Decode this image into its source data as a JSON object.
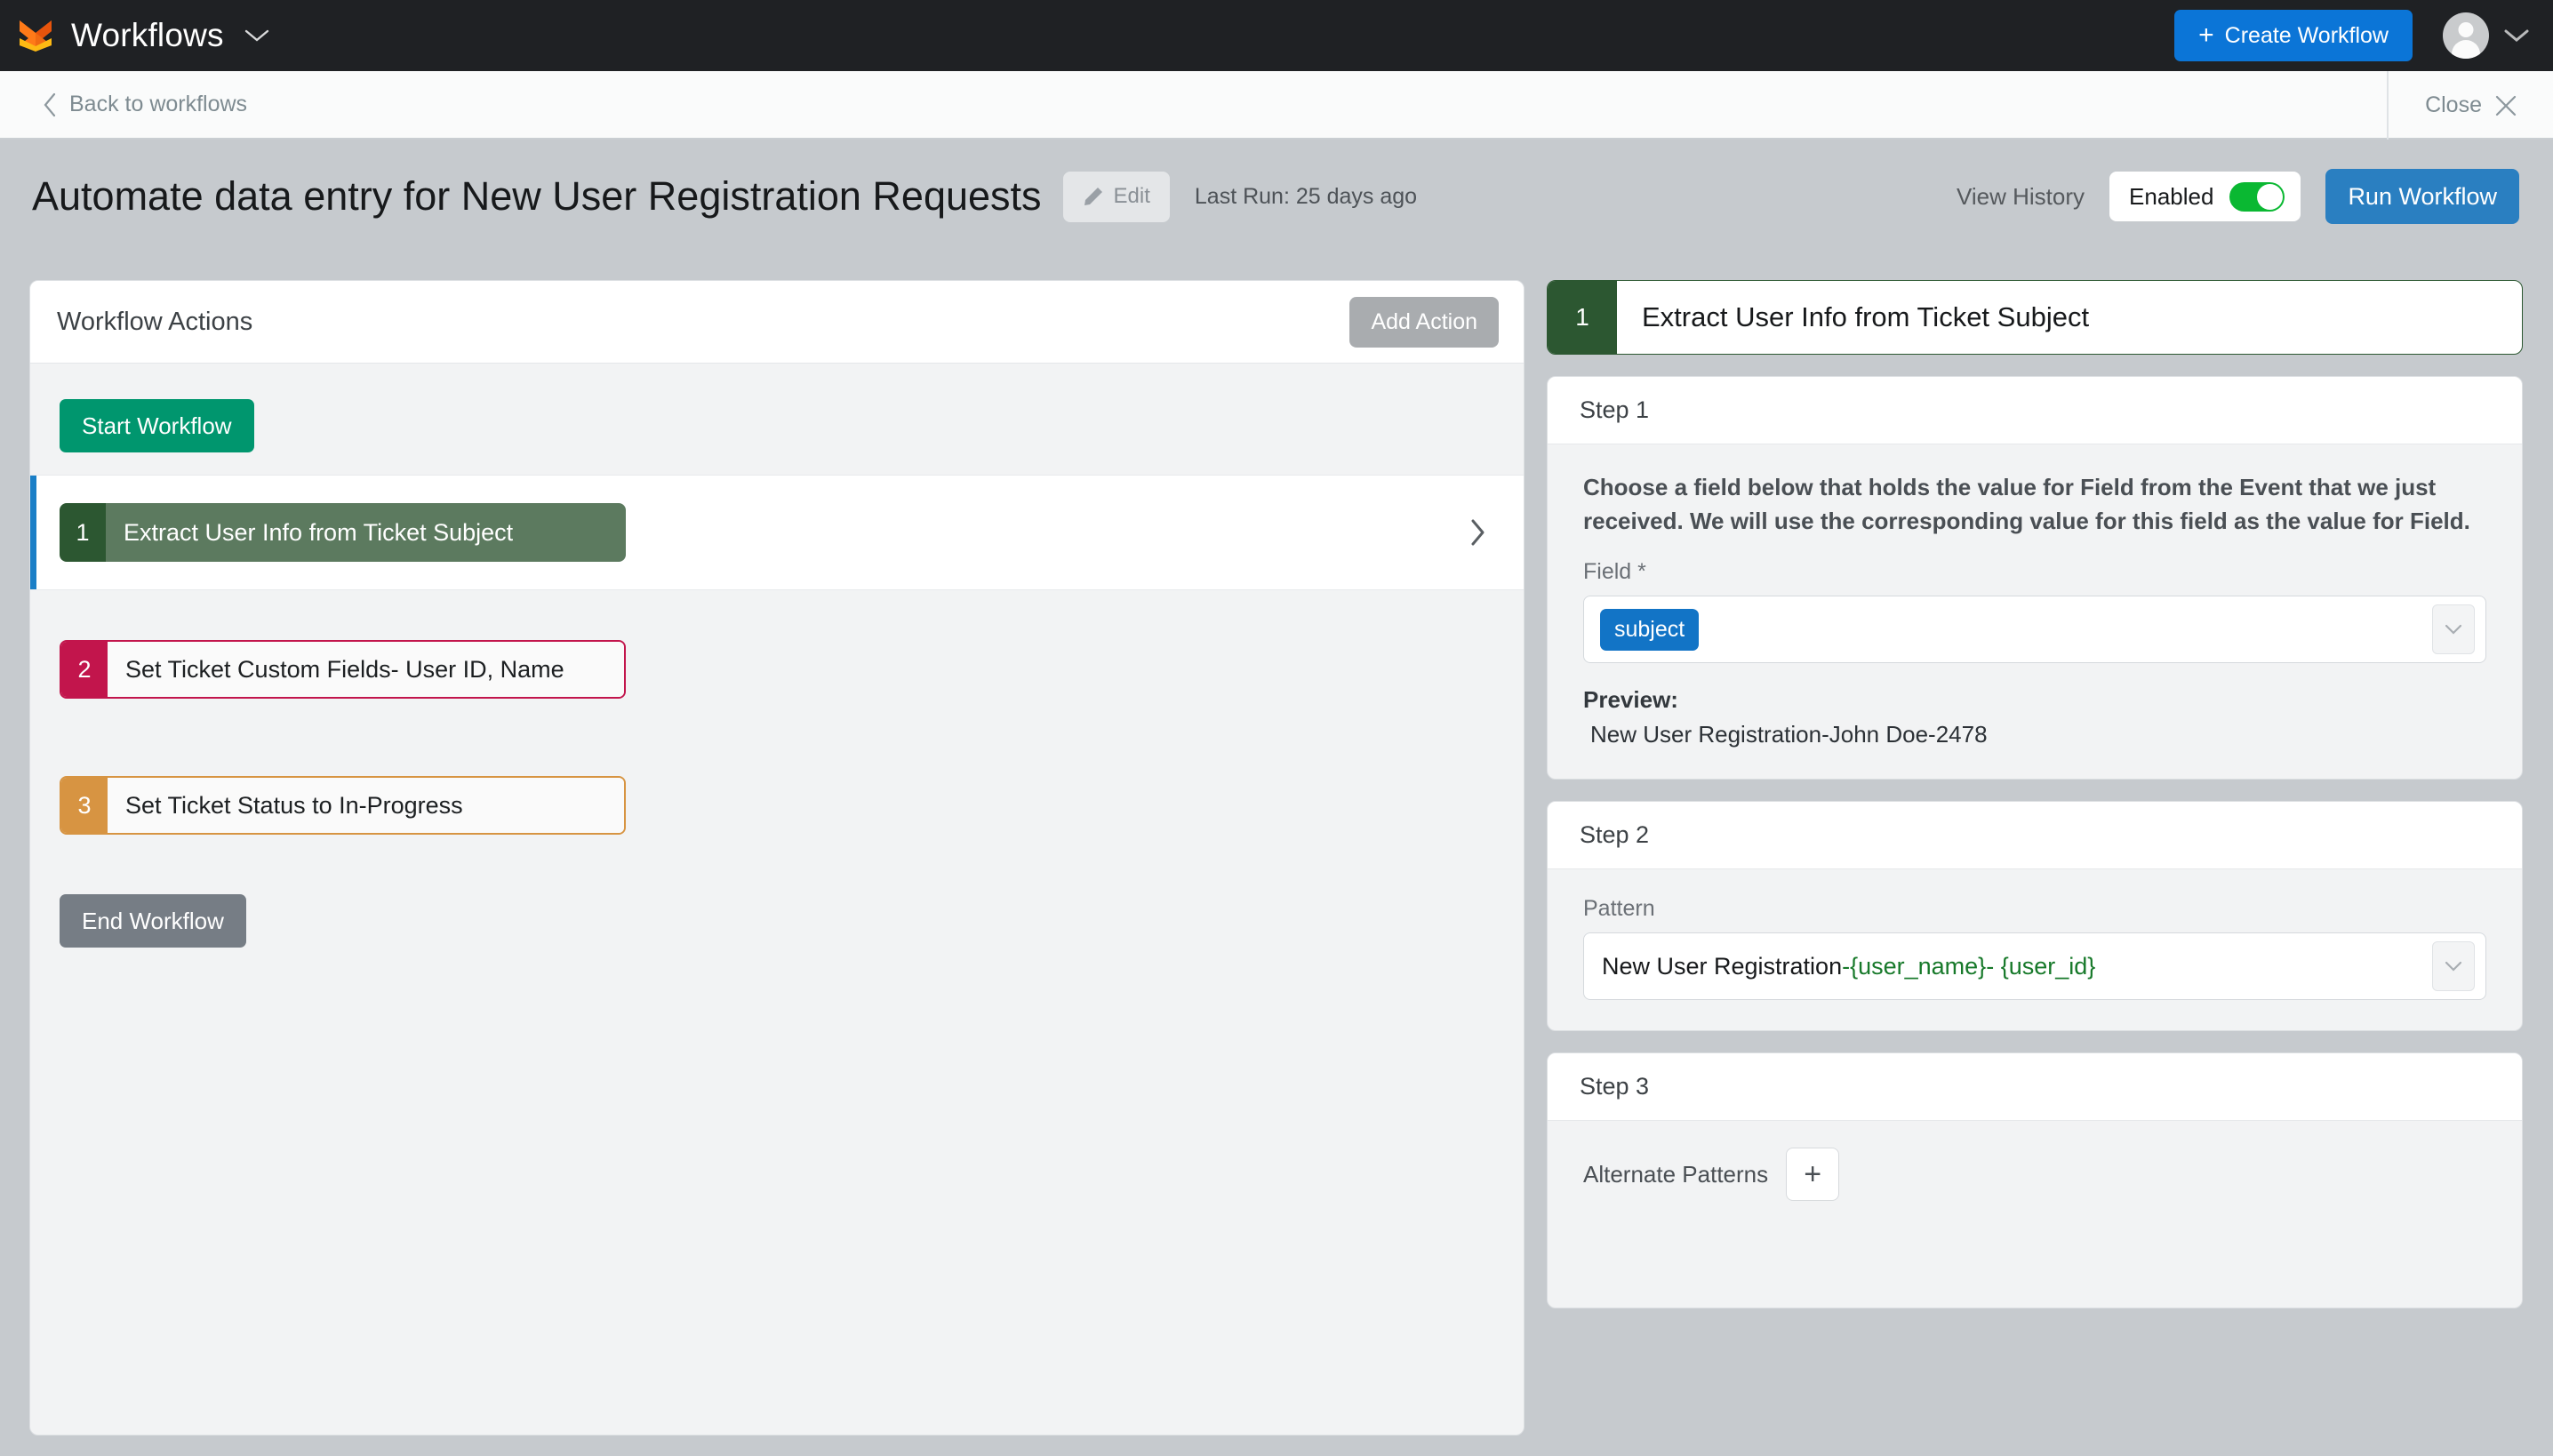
{
  "topbar": {
    "logo_icon": "fox-logo-icon",
    "brand": "Workflows",
    "brand_caret_icon": "chevron-down-icon",
    "create_button": "Create Workflow",
    "create_plus": "+",
    "avatar_icon": "user-avatar-icon",
    "avatar_caret_icon": "chevron-down-icon",
    "accent_blue": "#0b75d7",
    "background": "#1f2124"
  },
  "subbar": {
    "back_icon": "chevron-left-icon",
    "back_label": "Back to workflows",
    "close_label": "Close",
    "close_icon": "close-x-icon"
  },
  "title_row": {
    "workflow_title": "Automate data entry for New User Registration Requests",
    "edit_label": "Edit",
    "edit_icon": "pencil-icon",
    "last_run": "Last Run: 25 days ago",
    "view_history": "View History",
    "toggle_label": "Enabled",
    "toggle_on": true,
    "toggle_color": "#0ab832",
    "run_button": "Run Workflow",
    "run_button_color": "#2a7fc1"
  },
  "left_panel": {
    "header": "Workflow Actions",
    "add_action": "Add Action",
    "start_button": "Start Workflow",
    "start_color": "#00966e",
    "end_button": "End Workflow",
    "end_color": "#767d85",
    "row_chevron_icon": "chevron-right-icon",
    "actions": [
      {
        "number": "1",
        "label": "Extract User Info from Ticket Subject",
        "color": "#2c5731",
        "selected": true
      },
      {
        "number": "2",
        "label": "Set Ticket Custom Fields- User ID, Name",
        "color": "#c2154c",
        "selected": false
      },
      {
        "number": "3",
        "label": "Set Ticket Status to In-Progress",
        "color": "#d79442",
        "selected": false
      }
    ]
  },
  "right_panel": {
    "header_number": "1",
    "header_title": "Extract User Info from Ticket Subject",
    "header_color": "#2c5731",
    "steps": [
      {
        "title": "Step 1",
        "description": "Choose a field below that holds the value for Field from the Event that we just received. We will use the corresponding value for this field as the value for Field.",
        "field_label": "Field *",
        "field_token": "subject",
        "field_caret_icon": "chevron-down-icon",
        "preview_label": "Preview:",
        "preview_value": "New User Registration-John Doe-2478"
      },
      {
        "title": "Step 2",
        "pattern_label": "Pattern",
        "pattern_static": "New User Registration",
        "pattern_variables": "-{user_name}- {user_id}",
        "pattern_variable_color": "#17792a",
        "pattern_caret_icon": "chevron-down-icon"
      },
      {
        "title": "Step 3",
        "alternate_patterns_label": "Alternate Patterns",
        "add_pattern_icon": "plus-icon",
        "add_pattern_label": "+"
      }
    ]
  }
}
